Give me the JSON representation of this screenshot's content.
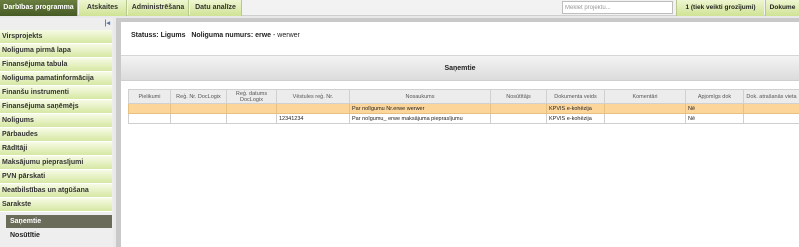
{
  "topbar": {
    "tabs": [
      {
        "label": "Darbības programma",
        "active": true
      },
      {
        "label": "Atskaites",
        "active": false
      },
      {
        "label": "Administrēšana",
        "active": false
      },
      {
        "label": "Datu analīze",
        "active": false
      }
    ],
    "search_placeholder": "Meklēt projektu...",
    "task_button": "1 (tiek veikti grozījumi)",
    "docs_button": "Dokume"
  },
  "sidebar": {
    "collapse_icon": "|◂",
    "items": [
      "Virsprojekts",
      "Noliguma pirmā lapa",
      "Finansējuma tabula",
      "Noliguma pamatinformācija",
      "Finanšu instrumenti",
      "Finansējuma saņēmējs",
      "Noligums",
      "Pārbaudes",
      "Rādītāji",
      "Maksājumu pieprasījumi",
      "PVN pārskati",
      "Neatbilstības un atgūšana",
      "Sarakste"
    ],
    "subitems": [
      {
        "label": "Saņemtie",
        "active": true
      },
      {
        "label": "Nosūtītie",
        "active": false
      }
    ]
  },
  "main": {
    "status_label": "Statuss:",
    "status_value": "Ligums",
    "number_label": "Noliguma numurs:",
    "number_value": "erwe",
    "number_suffix": "- werwer",
    "section_title": "Saņemtie",
    "table": {
      "headers": [
        "Pielikumi",
        "Reģ. Nr. DocLogix",
        "Reģ. datums DocLogix",
        "Vēstules reģ. Nr.",
        "Nosaukums",
        "Nosūtītājs",
        "Dokumenta veids",
        "Komentāri",
        "Apjomīgs dok",
        "Dok. atrašanās vieta"
      ],
      "rows": [
        {
          "selected": true,
          "cells": [
            "",
            "",
            "",
            "",
            "Par nolīgumu Nr.erwe werwer",
            "",
            "KPVIS e-kohēzija",
            "",
            "Nē",
            ""
          ]
        },
        {
          "selected": false,
          "cells": [
            "",
            "",
            "",
            "12341234",
            "Par noīgumu_ erwe maksājuma pieprasījumu",
            "",
            "KPVIS e-kohēzija",
            "",
            "Nē",
            ""
          ]
        }
      ]
    }
  }
}
